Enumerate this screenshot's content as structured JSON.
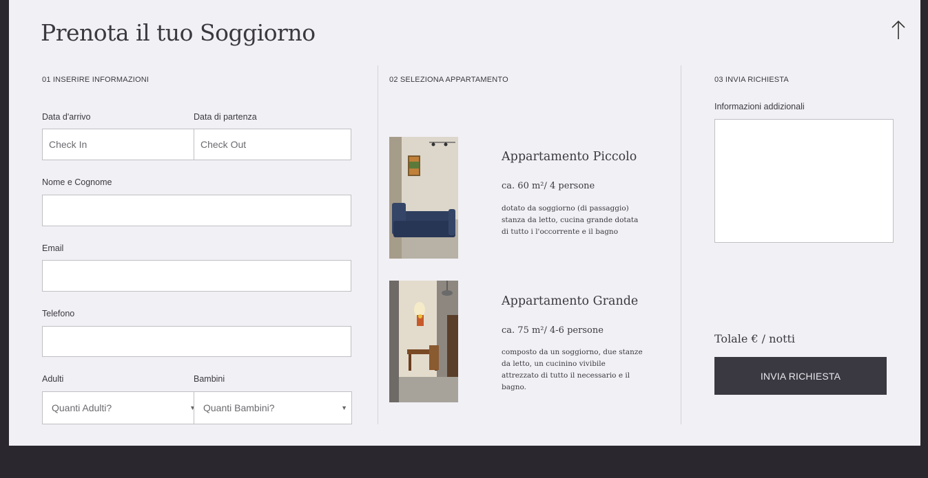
{
  "page": {
    "title": "Prenota il tuo Soggiorno"
  },
  "steps": {
    "step1": "01 INSERIRE INFORMAZIONI",
    "step2": "02 SELEZIONA APPARTAMENTO",
    "step3": "03 INVIA RICHIESTA"
  },
  "form": {
    "arrival_label": "Data d'arrivo",
    "arrival_placeholder": "Check In",
    "departure_label": "Data di partenza",
    "departure_placeholder": "Check Out",
    "name_label": "Nome e Cognome",
    "name_value": "",
    "email_label": "Email",
    "email_value": "",
    "phone_label": "Telefono",
    "phone_value": "",
    "adults_label": "Adulti",
    "adults_selected": "Quanti Adulti?",
    "children_label": "Bambini",
    "children_selected": "Quanti Bambini?"
  },
  "apartments": [
    {
      "name": "Appartamento Piccolo",
      "size": "ca. 60 m²/ 4 persone",
      "description": "dotato da soggiorno (di passaggio) stanza da letto, cucina grande dotata di tutto i l'occorrente e il bagno"
    },
    {
      "name": "Appartamento Grande",
      "size": "ca. 75 m²/ 4-6 persone",
      "description": "composto da un soggiorno, due stanze da letto, un cucinino vivibile attrezzato di tutto il necessario e il bagno."
    }
  ],
  "request": {
    "info_label": "Informazioni addizionali",
    "info_value": "",
    "total_text": "Tolale € / notti",
    "submit_label": "INVIA RICHIESTA"
  },
  "icons": {
    "scroll_top": "arrow-up-icon"
  },
  "colors": {
    "page_bg": "#f1f0f4",
    "outer_bg": "#2a282e",
    "button_bg": "#3a3941"
  }
}
